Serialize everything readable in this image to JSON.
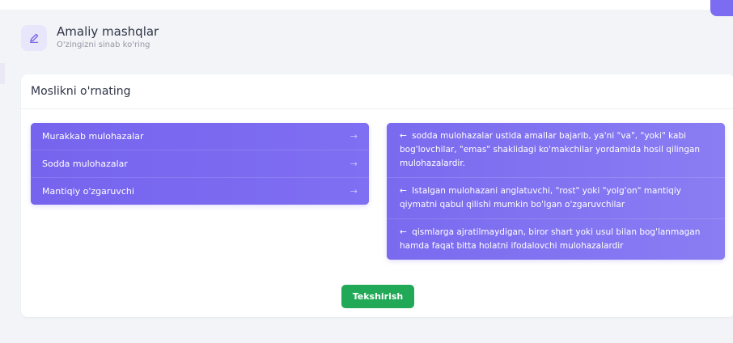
{
  "header": {
    "title": "Amaliy mashqlar",
    "subtitle": "O'zingizni sinab ko'ring",
    "icon": "pencil-icon"
  },
  "exercise": {
    "title": "Moslikni o'rnating",
    "terms": [
      {
        "label": "Murakkab mulohazalar",
        "arrow": "→"
      },
      {
        "label": "Sodda mulohazalar",
        "arrow": "→"
      },
      {
        "label": "Mantiqiy o'zgaruvchi",
        "arrow": "→"
      }
    ],
    "definitions": [
      {
        "arrow": "←",
        "text": "sodda mulohazalar ustida amallar bajarib, ya'ni \"va\", \"yoki\" kabi bog'lovchilar, \"emas\" shaklidagi ko'makchilar yordamida hosil qilingan mulohazalardir."
      },
      {
        "arrow": "←",
        "text": "Istalgan mulohazani anglatuvchi, \"rost\" yoki \"yolg'on\" mantiqiy qiymatni qabul qilishi mumkin bo'lgan o'zgaruvchilar"
      },
      {
        "arrow": "←",
        "text": "qismlarga ajratilmaydigan, biror shart yoki usul bilan bog'lanmagan hamda faqat bitta holatni ifodalovchi mulohazalardir"
      }
    ],
    "check_label": "Tekshirish"
  },
  "colors": {
    "accent": "#7967ef",
    "button": "#22a957",
    "page_bg": "#f3f4f7"
  }
}
